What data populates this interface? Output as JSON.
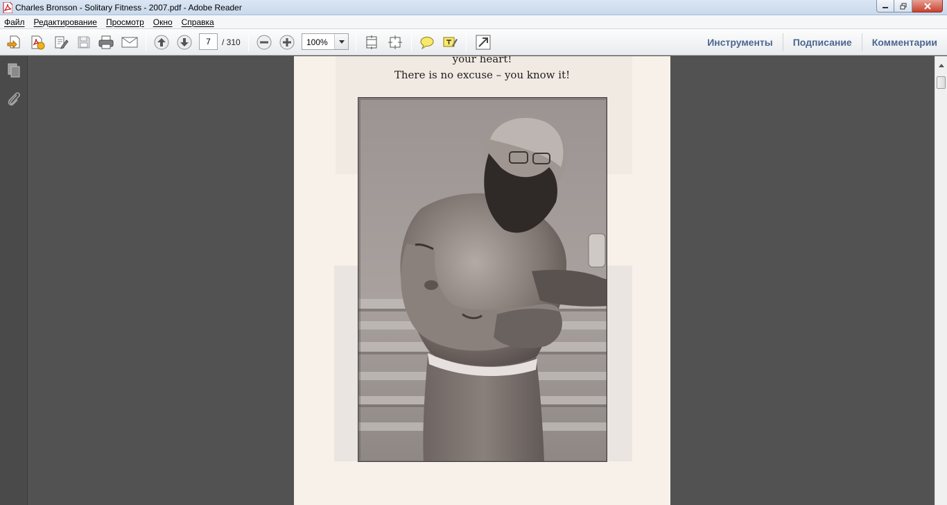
{
  "window": {
    "title": "Charles Bronson - Solitary Fitness - 2007.pdf - Adobe Reader"
  },
  "menu": {
    "items": [
      "Файл",
      "Редактирование",
      "Просмотр",
      "Окно",
      "Справка"
    ]
  },
  "toolbar": {
    "page_current": "7",
    "page_total": "/ 310",
    "zoom": "100%"
  },
  "right_tabs": {
    "tools": "Инструменты",
    "sign": "Подписание",
    "comments": "Комментарии"
  },
  "document": {
    "line1": "your heart!",
    "line2": "There is no excuse – you know it!"
  },
  "colors": {
    "accent": "#4c6690",
    "workspace": "#525252",
    "page": "#f8f1e9"
  },
  "icons": [
    "adobe-pdf-icon",
    "open-icon",
    "create-pdf-icon",
    "edit-icon",
    "save-icon",
    "print-icon",
    "email-icon",
    "page-up-icon",
    "page-down-icon",
    "zoom-out-icon",
    "zoom-in-icon",
    "fit-page-icon",
    "fit-width-icon",
    "comment-icon",
    "highlight-icon",
    "full-screen-icon",
    "pages-icon",
    "attachment-icon"
  ]
}
